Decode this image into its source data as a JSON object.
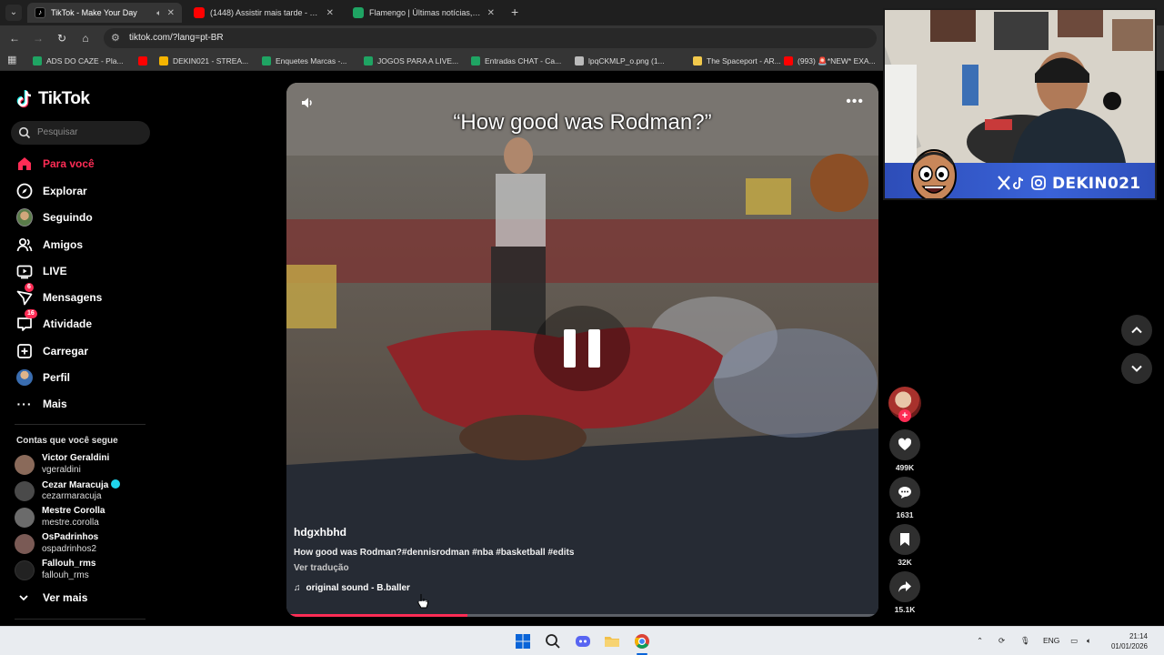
{
  "browser": {
    "tabs": [
      {
        "title": "TikTok - Make Your Day",
        "active": true,
        "favicon": "tiktok-favicon",
        "audio": true
      },
      {
        "title": "(1448) Assistir mais tarde - YouT",
        "active": false,
        "favicon": "youtube-favicon"
      },
      {
        "title": "Flamengo | Últimas notícias, res",
        "active": false,
        "favicon": "ge-favicon"
      }
    ],
    "new_tab_label": "+",
    "url": "tiktok.com/?lang=pt-BR",
    "bookmarks": [
      {
        "label": "ADS DO CAZE - Pla...",
        "icon": "sheets-icon",
        "color": "#1fa463"
      },
      {
        "label": "",
        "icon": "youtube-icon",
        "color": "#ff0000"
      },
      {
        "label": "DEKIN021 - STREA...",
        "icon": "drive-icon",
        "color": "#f4b400"
      },
      {
        "label": "Enquetes Marcas -...",
        "icon": "sheets-icon",
        "color": "#1fa463"
      },
      {
        "label": "JOGOS PARA A LIVE...",
        "icon": "sheets-icon",
        "color": "#1fa463"
      },
      {
        "label": "Entradas CHAT - Ca...",
        "icon": "sheets-icon",
        "color": "#1fa463"
      },
      {
        "label": "lpqCKMLP_o.png (1...",
        "icon": "globe-icon",
        "color": "#bbbbbb"
      },
      {
        "label": "The Spaceport - AR...",
        "icon": "spaceport-icon",
        "color": "#f2c94c"
      },
      {
        "label": "(993) 🚨*NEW* EXA...",
        "icon": "youtube-icon",
        "color": "#ff0000"
      }
    ]
  },
  "tiktok": {
    "brand": "TikTok",
    "search_placeholder": "Pesquisar",
    "nav": [
      {
        "label": "Para você",
        "icon": "home-icon",
        "active": true
      },
      {
        "label": "Explorar",
        "icon": "compass-icon"
      },
      {
        "label": "Seguindo",
        "icon": "following-avatar-icon"
      },
      {
        "label": "Amigos",
        "icon": "friends-icon"
      },
      {
        "label": "LIVE",
        "icon": "live-icon"
      },
      {
        "label": "Mensagens",
        "icon": "messages-icon",
        "badge": "6"
      },
      {
        "label": "Atividade",
        "icon": "activity-icon",
        "badge": "16"
      },
      {
        "label": "Carregar",
        "icon": "upload-icon"
      },
      {
        "label": "Perfil",
        "icon": "profile-avatar-icon"
      },
      {
        "label": "Mais",
        "icon": "more-dots-icon"
      }
    ],
    "following_title": "Contas que você segue",
    "accounts": [
      {
        "name": "Victor Geraldini",
        "handle": "vgeraldini",
        "color": "#8a6a5a"
      },
      {
        "name": "Cezar Maracuja",
        "handle": "cezarmaracuja",
        "verified": true,
        "color": "#4a4a4a"
      },
      {
        "name": "Mestre Corolla",
        "handle": "mestre.corolla",
        "color": "#6b6b6b"
      },
      {
        "name": "OsPadrinhos",
        "handle": "ospadrinhos2",
        "color": "#7a5a55"
      },
      {
        "name": "Fallouh_rms",
        "handle": "fallouh_rms",
        "color": "#222222"
      }
    ],
    "see_more": "Ver mais"
  },
  "video": {
    "overlay_text": "“How good was Rodman?”",
    "author": "hdgxhbhd",
    "description": "How good was Rodman?#dennisrodman #nba #basketball #edits",
    "translate": "Ver tradução",
    "sound": "original sound - B.baller",
    "progress": 0.305,
    "state": "paused"
  },
  "actions": {
    "likes": "499K",
    "comments": "1631",
    "saves": "32K",
    "shares": "15.1K"
  },
  "overlay_stream": {
    "handle": "DEKIN021",
    "socials": [
      "x-icon",
      "tiktok-icon",
      "instagram-icon"
    ]
  },
  "taskbar": {
    "lang": "ENG",
    "time": "21:14",
    "date": "01/01/2026"
  }
}
